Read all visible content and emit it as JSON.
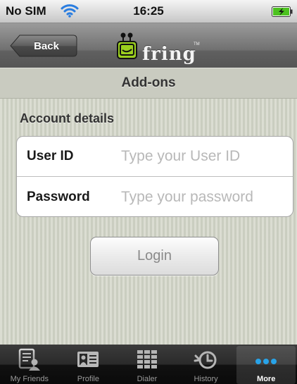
{
  "status_bar": {
    "carrier": "No SIM",
    "time": "16:25"
  },
  "nav_bar": {
    "back_label": "Back",
    "logo_text": "fring",
    "logo_tm": "TM"
  },
  "title_bar": {
    "title": "Add-ons"
  },
  "account": {
    "section_header": "Account details",
    "user_id_label": "User ID",
    "user_id_placeholder": "Type your User ID",
    "user_id_value": "",
    "password_label": "Password",
    "password_placeholder": "Type your password",
    "password_value": "",
    "login_label": "Login"
  },
  "tab_bar": {
    "tabs": [
      {
        "label": "My Friends",
        "icon": "contacts-list-icon",
        "active": false
      },
      {
        "label": "Profile",
        "icon": "profile-card-icon",
        "active": false
      },
      {
        "label": "Dialer",
        "icon": "keypad-icon",
        "active": false
      },
      {
        "label": "History",
        "icon": "history-clock-icon",
        "active": false
      },
      {
        "label": "More",
        "icon": "more-dots-icon",
        "active": true
      }
    ]
  },
  "colors": {
    "content_bg": "#d1d4c6",
    "logo_green": "#9bcf1e",
    "more_dots": "#28a3e8"
  }
}
